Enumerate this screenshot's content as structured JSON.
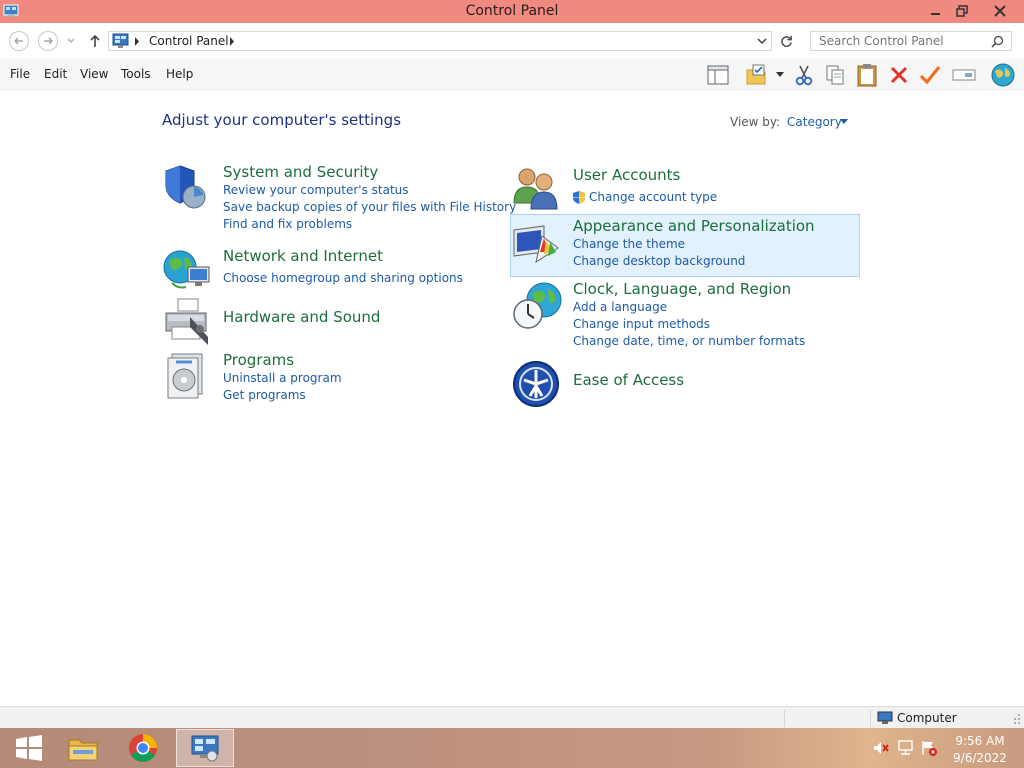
{
  "window": {
    "title": "Control Panel"
  },
  "address": {
    "crumb": "Control Panel"
  },
  "search": {
    "placeholder": "Search Control Panel"
  },
  "menu": [
    "File",
    "Edit",
    "View",
    "Tools",
    "Help"
  ],
  "content": {
    "heading": "Adjust your computer's settings",
    "view_by_label": "View by:",
    "view_by_value": "Category",
    "left": [
      {
        "title": "System and Security",
        "links": [
          "Review your computer's status",
          "Save backup copies of your files with File History",
          "Find and fix problems"
        ],
        "icon": "shield-icon"
      },
      {
        "title": "Network and Internet",
        "links": [
          "Choose homegroup and sharing options"
        ],
        "icon": "globe-network-icon"
      },
      {
        "title": "Hardware and Sound",
        "links": [],
        "icon": "printer-icon"
      },
      {
        "title": "Programs",
        "links": [
          "Uninstall a program",
          "Get programs"
        ],
        "icon": "programs-icon"
      }
    ],
    "right": [
      {
        "title": "User Accounts",
        "links": [
          "Change account type"
        ],
        "icon": "users-icon"
      },
      {
        "title": "Appearance and Personalization",
        "links": [
          "Change the theme",
          "Change desktop background"
        ],
        "icon": "monitor-palette-icon"
      },
      {
        "title": "Clock, Language, and Region",
        "links": [
          "Add a language",
          "Change input methods",
          "Change date, time, or number formats"
        ],
        "icon": "clock-globe-icon"
      },
      {
        "title": "Ease of Access",
        "links": [],
        "icon": "ease-of-access-icon"
      }
    ]
  },
  "status": {
    "location": "Computer"
  },
  "taskbar": {
    "time": "9:56 AM",
    "date": "9/6/2022"
  },
  "colors": {
    "titlebar": "#f08a80",
    "link": "#1e5ba8",
    "category_title": "#1c6e3c",
    "heading": "#1e3287",
    "highlight": "#e2f1fb"
  }
}
